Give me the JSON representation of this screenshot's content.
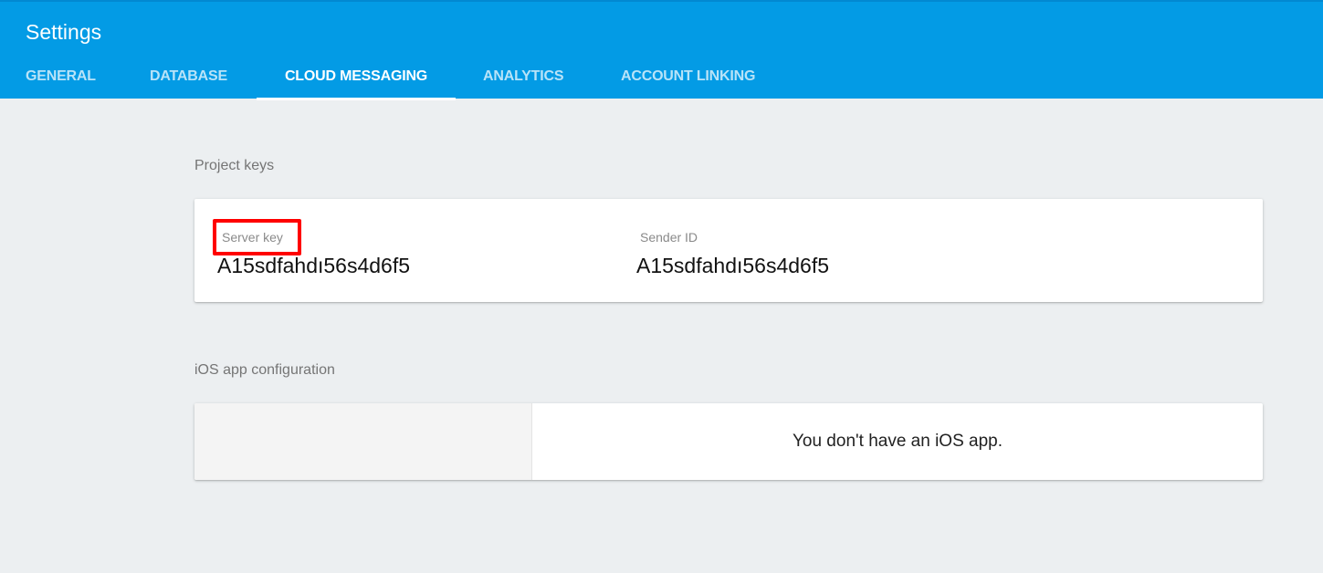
{
  "header": {
    "title": "Settings",
    "tabs": [
      {
        "label": "GENERAL",
        "active": false
      },
      {
        "label": "DATABASE",
        "active": false
      },
      {
        "label": "CLOUD MESSAGING",
        "active": true
      },
      {
        "label": "ANALYTICS",
        "active": false
      },
      {
        "label": "ACCOUNT LINKING",
        "active": false
      }
    ]
  },
  "project_keys": {
    "section_label": "Project keys",
    "server_key": {
      "label": "Server key",
      "value": "A15sdfahdı56s4d6f5",
      "highlighted": true
    },
    "sender_id": {
      "label": "Sender ID",
      "value": "A15sdfahdı56s4d6f5"
    }
  },
  "ios_config": {
    "section_label": "iOS app configuration",
    "message": "You don't have an iOS app."
  },
  "colors": {
    "header_bg": "#039be5",
    "page_bg": "#eceff1",
    "highlight": "#ff0000"
  }
}
